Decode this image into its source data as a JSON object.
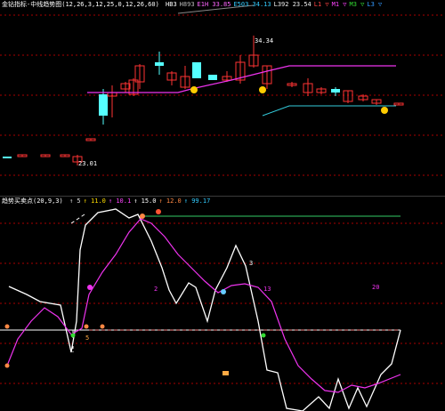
{
  "main_header": {
    "title": "金钻指标-中线趋势图(",
    "params": "12,26,3,12,25,0,12,26,60)",
    "items": [
      {
        "text": "HB3",
        "color": "#ffffff"
      },
      {
        "text": "H893",
        "color": "#bbbbbb"
      },
      {
        "text": "E1H 33.85",
        "color": "#ff66ff"
      },
      {
        "text": "E503 34.13",
        "color": "#33ccff"
      },
      {
        "text": "L392 23.54",
        "color": "#eeeeee"
      },
      {
        "text": "L1 ▽",
        "color": "#ff4444"
      },
      {
        "text": "M1 ▽",
        "color": "#ff44ff"
      },
      {
        "text": "M3 ▽",
        "color": "#33dd33"
      },
      {
        "text": "L3 ▽",
        "color": "#3399ff"
      }
    ]
  },
  "price_labels": {
    "high": "34.34",
    "low": "23.01"
  },
  "indicator_header": {
    "title": "趋势买卖点(20,9,3)",
    "items": [
      {
        "text": "↑ 5",
        "color": "#dddddd"
      },
      {
        "text": "↑ 11.0",
        "color": "#ffdd00"
      },
      {
        "text": "↑ 10.1",
        "color": "#ff44ff"
      },
      {
        "text": "↑ 15.0",
        "color": "#ffffff"
      },
      {
        "text": "↑ 12.0",
        "color": "#ff8844"
      },
      {
        "text": "↑ 99.17",
        "color": "#33ccff"
      }
    ]
  },
  "colors": {
    "up": "#ff3333",
    "down": "#55ffff",
    "ma_magenta": "#ee33ee",
    "ma_cyan": "#33ccdd",
    "grid": "#aa0000",
    "white_line": "#ffffff",
    "green_line": "#33cc66"
  },
  "indicator_labels": {
    "a": "2",
    "b": "3",
    "c": "13",
    "d": "20",
    "e": "5"
  }
}
